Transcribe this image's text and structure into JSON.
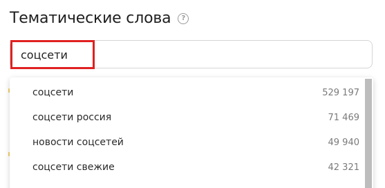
{
  "header": {
    "title": "Тематические слова",
    "help_icon": "question-circle-icon"
  },
  "search": {
    "value": "соцсети"
  },
  "suggestions": [
    {
      "text": "соцсети",
      "count": "529 197"
    },
    {
      "text": "соцсети россия",
      "count": "71 469"
    },
    {
      "text": "новости соцсетей",
      "count": "49 940"
    },
    {
      "text": "соцсети свежие",
      "count": "42 321"
    }
  ],
  "colors": {
    "highlight": "#e02020",
    "title_text": "#1f1f1f",
    "count_text": "#7a7a7a",
    "scrollbar_thumb": "#bdbdbd"
  }
}
